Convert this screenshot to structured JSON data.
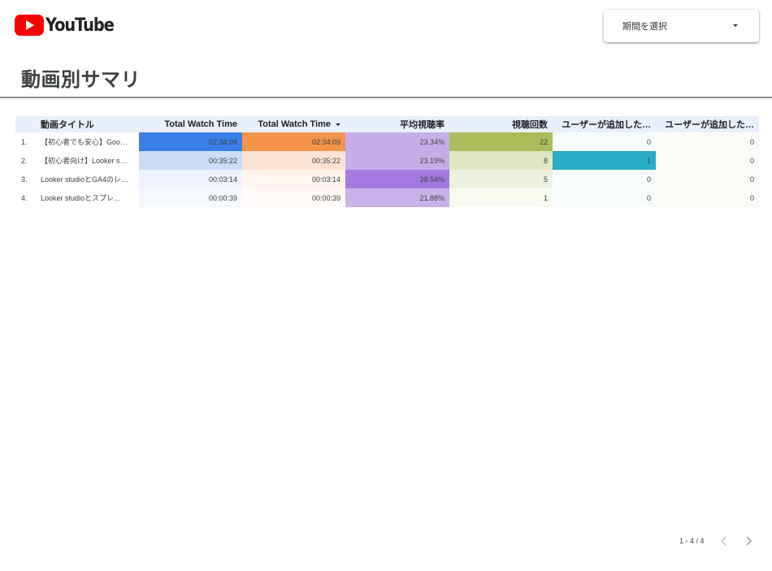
{
  "brand": {
    "logo_text": "YouTube",
    "logo_color": "#ff0000"
  },
  "date_picker": {
    "label": "期間を選択"
  },
  "page": {
    "title": "動画別サマリ"
  },
  "table": {
    "columns": [
      "動画タイトル",
      "Total Watch Time",
      "Total Watch Time",
      "平均視聴率",
      "視聴回数",
      "ユーザーが追加した…",
      "ユーザーが追加した…"
    ],
    "sorted_column": 2,
    "rows": [
      {
        "index": "1.",
        "title": "【初心者でも安心】Goo…",
        "watch_time_1": "02:34:09",
        "watch_time_2": "02:34:09",
        "avg_view_rate": "23.34%",
        "views": "22",
        "user_added_1": "0",
        "user_added_2": "0"
      },
      {
        "index": "2.",
        "title": "【初心者向け】Looker s…",
        "watch_time_1": "00:35:22",
        "watch_time_2": "00:35:22",
        "avg_view_rate": "23.19%",
        "views": "8",
        "user_added_1": "1",
        "user_added_2": "0"
      },
      {
        "index": "3.",
        "title": "Looker studioとGA4のレ…",
        "watch_time_1": "00:03:14",
        "watch_time_2": "00:03:14",
        "avg_view_rate": "38.54%",
        "views": "5",
        "user_added_1": "0",
        "user_added_2": "0"
      },
      {
        "index": "4.",
        "title": "Looker studioとスプレ…",
        "watch_time_1": "00:00:39",
        "watch_time_2": "00:00:39",
        "avg_view_rate": "21.88%",
        "views": "1",
        "user_added_1": "0",
        "user_added_2": "0"
      }
    ],
    "heat_colors": {
      "watch_time_1": [
        "#3b7ee8",
        "#cadcf8",
        "#eef3fd",
        "#f5f8fe"
      ],
      "watch_time_2": [
        "#f4934c",
        "#fde3d3",
        "#fef5ef",
        "#fffaf7"
      ],
      "avg_view_rate": [
        "#c7aeea",
        "#c6ade9",
        "#a578e0",
        "#c9b1ea"
      ],
      "views": [
        "#aabd5a",
        "#dfe6c4",
        "#edf1e0",
        "#f7f9f0"
      ],
      "user_added_1": [
        "#f6fbfc",
        "#2aacc2",
        "#f6fbfc",
        "#f6fbfc"
      ],
      "user_added_2": [
        "#fdfbf8",
        "#fdfbf8",
        "#fdfbf8",
        "#fdfbf8"
      ]
    }
  },
  "pagination": {
    "label": "1 - 4 / 4"
  }
}
